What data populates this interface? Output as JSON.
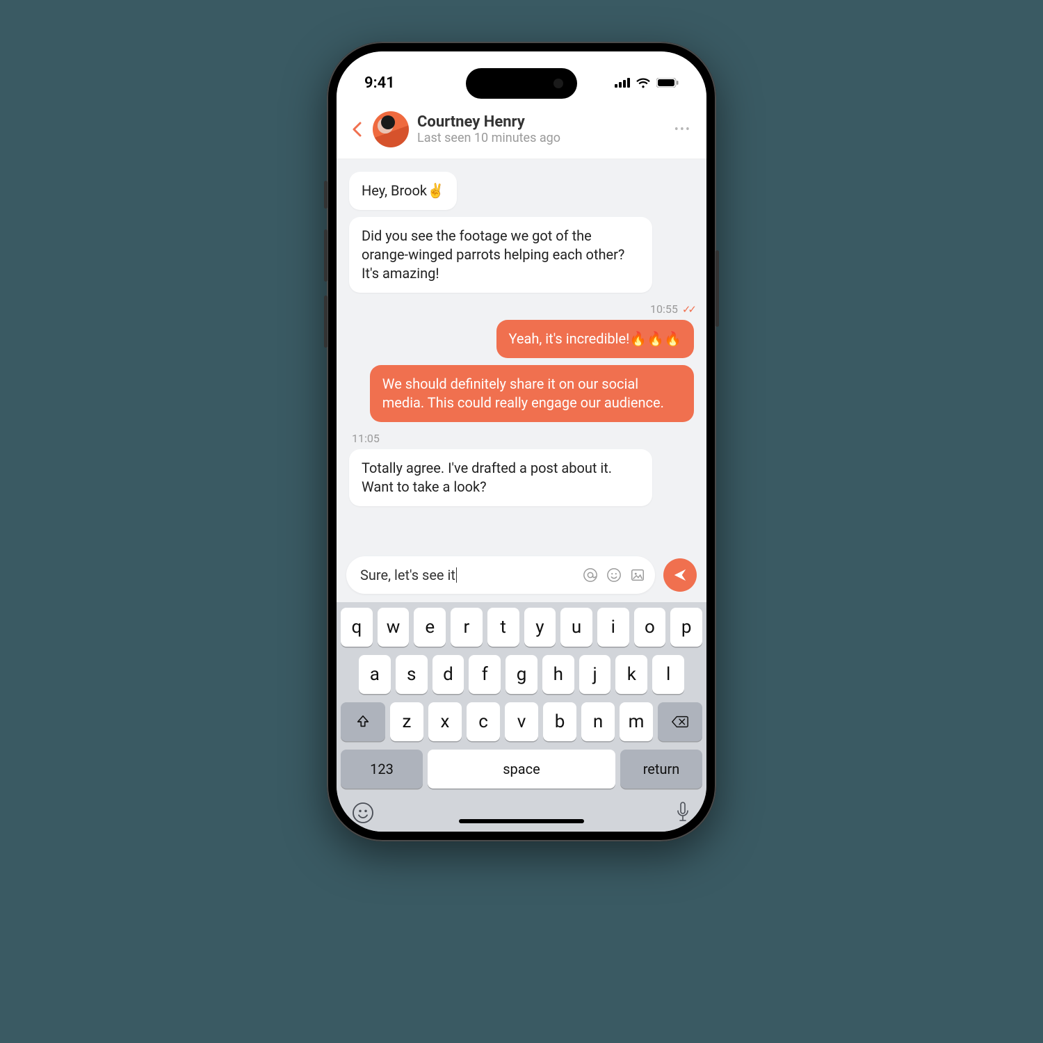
{
  "status_bar": {
    "time": "9:41"
  },
  "header": {
    "name": "Courtney Henry",
    "status": "Last seen 10 minutes ago"
  },
  "messages": {
    "m1": "Hey, Brook✌️",
    "m2": "Did you see the footage we got of the orange-winged parrots helping each other? It's amazing!",
    "t_out": "10:55",
    "m3": "Yeah, it's incredible!🔥🔥🔥",
    "m4": "We should definitely share it on our social media. This could really engage our audience.",
    "t_in2": "11:05",
    "m5": "Totally agree. I've drafted a post about it. Want to take a look?"
  },
  "composer": {
    "text": "Sure, let's see it"
  },
  "keyboard": {
    "row1": [
      "q",
      "w",
      "e",
      "r",
      "t",
      "y",
      "u",
      "i",
      "o",
      "p"
    ],
    "row2": [
      "a",
      "s",
      "d",
      "f",
      "g",
      "h",
      "j",
      "k",
      "l"
    ],
    "row3": [
      "z",
      "x",
      "c",
      "v",
      "b",
      "n",
      "m"
    ],
    "numkey": "123",
    "space": "space",
    "return": "return"
  }
}
